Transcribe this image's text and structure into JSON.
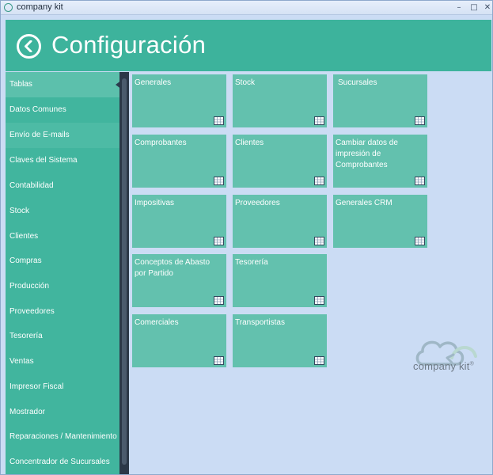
{
  "window": {
    "title": "company kit",
    "minimize_glyph": "–",
    "maximize_glyph": "□",
    "close_glyph": "✕"
  },
  "header": {
    "title": "Configuración",
    "back_icon": "back-arrow-icon",
    "background": "#3db39c"
  },
  "sidebar": {
    "items": [
      {
        "label": "Tablas"
      },
      {
        "label": "Datos Comunes"
      },
      {
        "label": "Envío de E-mails"
      },
      {
        "label": "Claves del Sistema"
      },
      {
        "label": "Contabilidad"
      },
      {
        "label": "Stock"
      },
      {
        "label": "Clientes"
      },
      {
        "label": "Compras"
      },
      {
        "label": "Producción"
      },
      {
        "label": "Proveedores"
      },
      {
        "label": "Tesorería"
      },
      {
        "label": "Ventas"
      },
      {
        "label": "Impresor Fiscal"
      },
      {
        "label": "Mostrador"
      },
      {
        "label": "Reparaciones / Mantenimiento"
      },
      {
        "label": "Concentrador de Sucursales"
      }
    ]
  },
  "tiles": [
    {
      "label": "Generales"
    },
    {
      "label": "Stock"
    },
    {
      "label": "Sucursales"
    },
    {
      "label": "Comprobantes"
    },
    {
      "label": "Clientes"
    },
    {
      "label": "Cambiar datos de impresión de Comprobantes"
    },
    {
      "label": "Impositivas"
    },
    {
      "label": "Proveedores"
    },
    {
      "label": "Generales CRM"
    },
    {
      "label": "Conceptos de Abasto por Partido"
    },
    {
      "label": "Tesorería"
    },
    {
      "label": "Comerciales"
    },
    {
      "label": "Transportistas"
    }
  ],
  "logo": {
    "text": "company kit",
    "mark": "®"
  },
  "colors": {
    "accent": "#3db39c",
    "tile": "#63c1ae",
    "background": "#cbdcf4"
  }
}
